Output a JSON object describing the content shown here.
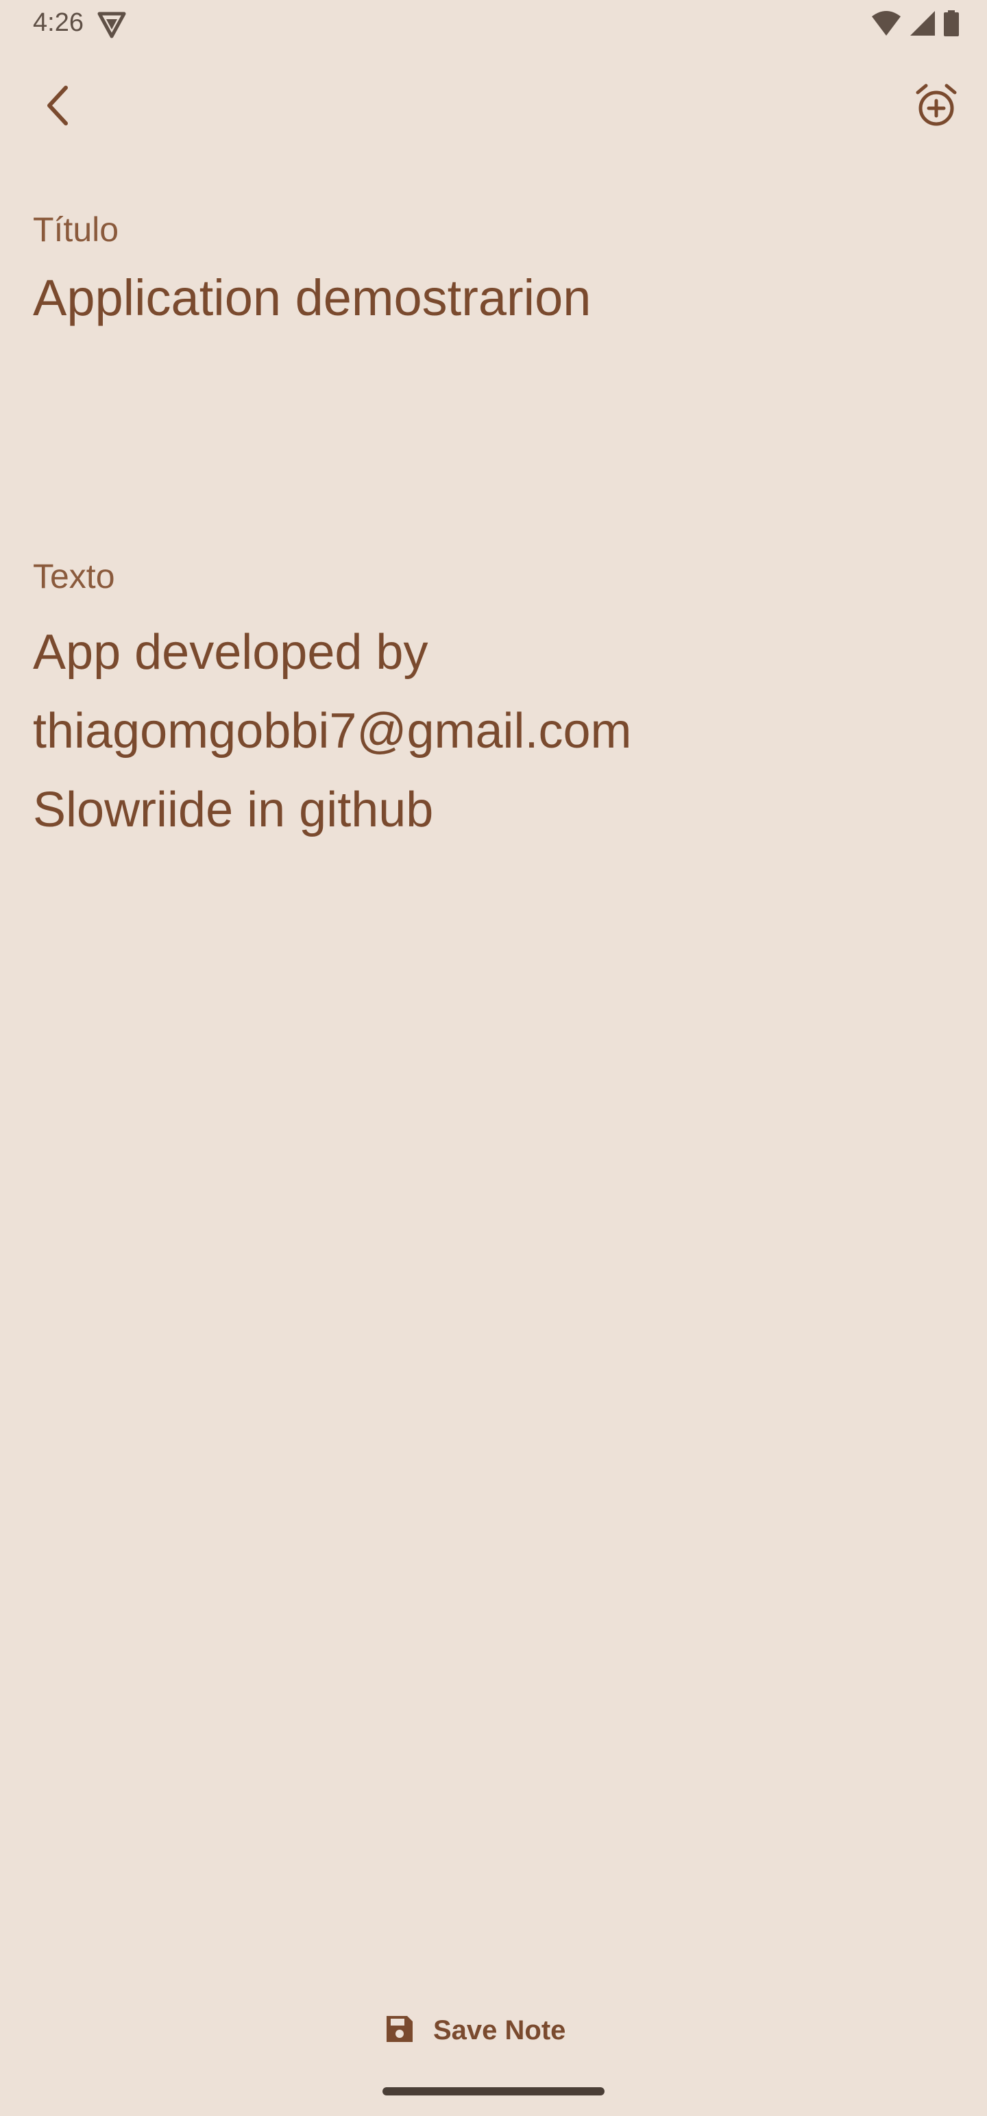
{
  "status_bar": {
    "time": "4:26",
    "icons": [
      "vpn-shield-icon",
      "wifi-icon",
      "cellular-signal-icon",
      "battery-icon"
    ]
  },
  "top_bar": {
    "back_icon": "chevron-left-icon",
    "alarm_icon": "alarm-add-icon"
  },
  "form": {
    "title_label": "Título",
    "title_value": "Application demostrarion",
    "text_label": "Texto",
    "text_lines": [
      "App developed by",
      "thiagomgobbi7@gmail.com",
      "Slowriide in github"
    ]
  },
  "footer": {
    "save_label": "Save Note",
    "save_icon": "save-floppy-icon"
  },
  "colors": {
    "background": "#ede1d7",
    "accent": "#7a4a2e"
  }
}
